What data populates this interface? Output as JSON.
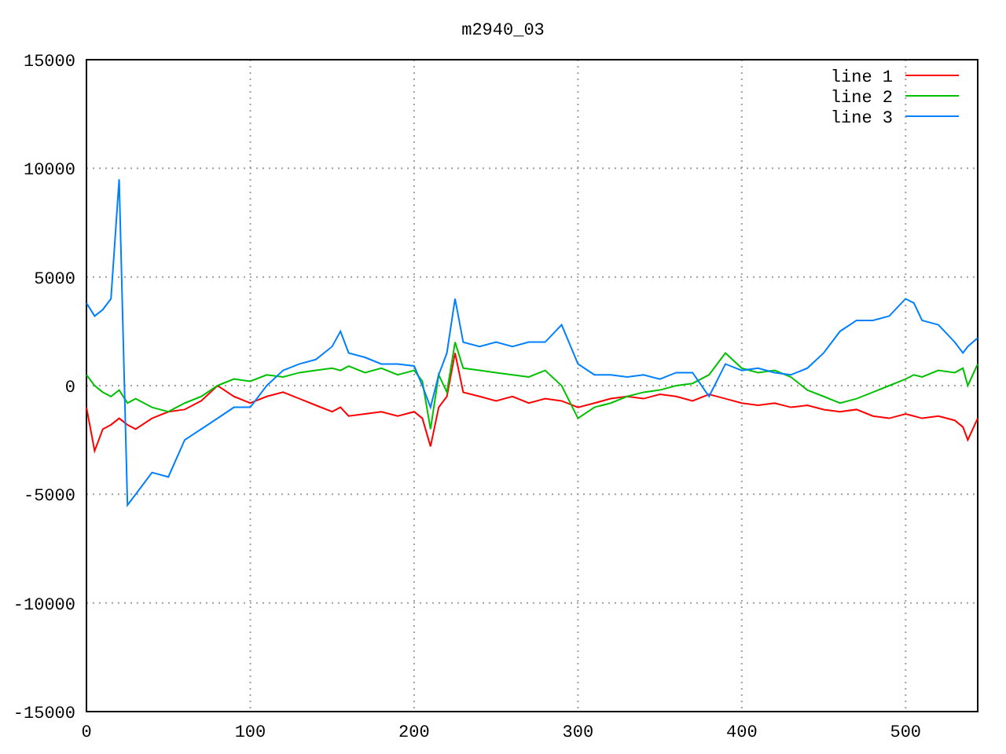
{
  "chart_data": {
    "type": "line",
    "title": "m2940_03",
    "x": [
      0,
      5,
      10,
      15,
      20,
      25,
      30,
      40,
      50,
      60,
      70,
      80,
      90,
      100,
      110,
      120,
      130,
      140,
      150,
      155,
      160,
      170,
      180,
      190,
      200,
      205,
      210,
      215,
      220,
      225,
      230,
      240,
      250,
      260,
      270,
      280,
      290,
      300,
      310,
      320,
      330,
      340,
      350,
      360,
      370,
      380,
      390,
      400,
      410,
      420,
      430,
      440,
      450,
      460,
      470,
      480,
      490,
      500,
      505,
      510,
      520,
      530,
      535,
      538,
      544
    ],
    "grid": true,
    "legend": true,
    "xlim": [
      0,
      544
    ],
    "ylim": [
      -15000,
      15000
    ],
    "xticks": [
      0,
      100,
      200,
      300,
      400,
      500
    ],
    "yticks": [
      -15000,
      -10000,
      -5000,
      0,
      5000,
      10000,
      15000
    ],
    "series": [
      {
        "name": "line 1",
        "color": "#ff0000",
        "values": [
          -1000,
          -3000,
          -2000,
          -1800,
          -1500,
          -1800,
          -2000,
          -1500,
          -1200,
          -1100,
          -700,
          0,
          -500,
          -800,
          -500,
          -300,
          -600,
          -900,
          -1200,
          -1000,
          -1400,
          -1300,
          -1200,
          -1400,
          -1200,
          -1500,
          -2800,
          -1000,
          -500,
          1500,
          -300,
          -500,
          -700,
          -500,
          -800,
          -600,
          -700,
          -1000,
          -800,
          -600,
          -500,
          -600,
          -400,
          -500,
          -700,
          -400,
          -600,
          -800,
          -900,
          -800,
          -1000,
          -900,
          -1100,
          -1200,
          -1100,
          -1400,
          -1500,
          -1300,
          -1400,
          -1500,
          -1400,
          -1600,
          -1900,
          -2500,
          -1500
        ]
      },
      {
        "name": "line 2",
        "color": "#00c000",
        "values": [
          500,
          0,
          -300,
          -500,
          -200,
          -800,
          -600,
          -1000,
          -1200,
          -800,
          -500,
          0,
          300,
          200,
          500,
          400,
          600,
          700,
          800,
          700,
          900,
          600,
          800,
          500,
          700,
          200,
          -2000,
          500,
          -300,
          2000,
          800,
          700,
          600,
          500,
          400,
          700,
          0,
          -1500,
          -1000,
          -800,
          -500,
          -300,
          -200,
          0,
          100,
          500,
          1500,
          800,
          600,
          700,
          400,
          -200,
          -500,
          -800,
          -600,
          -300,
          0,
          300,
          500,
          400,
          700,
          600,
          800,
          0,
          1000
        ]
      },
      {
        "name": "line 3",
        "color": "#0080ff",
        "values": [
          3800,
          3200,
          3500,
          4000,
          9500,
          -5500,
          -5000,
          -4000,
          -4200,
          -2500,
          -2000,
          -1500,
          -1000,
          -1000,
          0,
          700,
          1000,
          1200,
          1800,
          2500,
          1500,
          1300,
          1000,
          1000,
          900,
          0,
          -1000,
          500,
          1500,
          4000,
          2000,
          1800,
          2000,
          1800,
          2000,
          2000,
          2800,
          1000,
          500,
          500,
          400,
          500,
          300,
          600,
          600,
          -500,
          1000,
          700,
          800,
          600,
          500,
          800,
          1500,
          2500,
          3000,
          3000,
          3200,
          4000,
          3800,
          3000,
          2800,
          2000,
          1500,
          1800,
          2200
        ]
      }
    ]
  }
}
